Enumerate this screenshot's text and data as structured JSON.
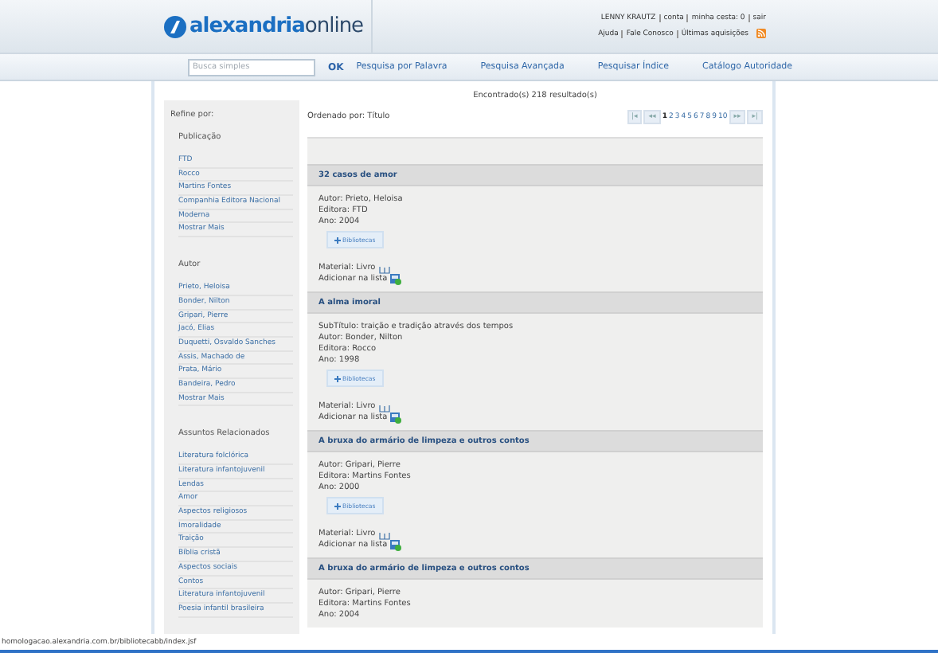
{
  "header": {
    "logo": {
      "part1": "alexandria",
      "part2": "online"
    },
    "user_links": [
      "LENNY KRAUTZ",
      "conta",
      "minha cesta: 0",
      "sair"
    ],
    "help_links": [
      "Ajuda",
      "Fale Conosco",
      "Últimas aquisições"
    ]
  },
  "nav": {
    "search": {
      "placeholder": "Busca simples"
    },
    "button": "OK",
    "links": [
      "Pesquisa por Palavra",
      "Pesquisa Avançada",
      "Pesquisar Índice",
      "Catálogo Autoridade"
    ]
  },
  "sidebar": {
    "title": "Refine por:",
    "groups": [
      {
        "title": "Publicação",
        "items": [
          "FTD",
          "Rocco",
          "Martins Fontes",
          "Companhia Editora Nacional",
          "Moderna",
          "Mostrar Mais"
        ]
      },
      {
        "title": "Autor",
        "items": [
          "Prieto, Heloisa",
          "Bonder, Nilton",
          "Gripari, Pierre",
          "Jacó, Elias",
          "Duquetti, Osvaldo Sanches",
          "Assis, Machado de",
          "Prata, Mário",
          "Bandeira, Pedro",
          "Mostrar Mais"
        ]
      },
      {
        "title": "Assuntos Relacionados",
        "items": [
          "Literatura folclórica",
          "Literatura infantojuvenil",
          "Lendas",
          "Amor",
          "Aspectos religiosos",
          "Imoralidade",
          "Traição",
          "Bíblia cristã",
          "Aspectos sociais",
          "Contos",
          "Literatura infantojuvenil",
          "Poesia infantil brasileira"
        ]
      }
    ]
  },
  "results": {
    "count": "Encontrado(s) 218 resultado(s)",
    "sort": "Ordenado por: Título",
    "pagination": {
      "first": "|◂",
      "prev": "◂◂",
      "pages": [
        {
          "label": "1",
          "selected": true
        },
        {
          "label": "2",
          "selected": false
        },
        {
          "label": "3",
          "selected": false
        },
        {
          "label": "4",
          "selected": false
        },
        {
          "label": "5",
          "selected": false
        },
        {
          "label": "6",
          "selected": false
        },
        {
          "label": "7",
          "selected": false
        },
        {
          "label": "8",
          "selected": false
        },
        {
          "label": "9",
          "selected": false
        },
        {
          "label": "10",
          "selected": false
        }
      ],
      "next": "▸▸",
      "last": "▸|"
    },
    "records": [
      {
        "title": "32 casos de amor",
        "lines": [
          "Autor: Prieto, Heloisa",
          "Editora: FTD",
          "Ano: 2004"
        ],
        "button": "Bibliotecas",
        "material": "Material: Livro",
        "add": "Adicionar na lista"
      },
      {
        "title": "A alma imoral",
        "lines": [
          "SubTítulo: traição e tradição através dos tempos",
          "Autor: Bonder, Nilton",
          "Editora: Rocco",
          "Ano: 1998"
        ],
        "button": "Bibliotecas",
        "material": "Material: Livro",
        "add": "Adicionar na lista"
      },
      {
        "title": "A bruxa do armário de limpeza e outros contos",
        "lines": [
          "Autor: Gripari, Pierre",
          "Editora: Martins Fontes",
          "Ano: 2000"
        ],
        "button": "Bibliotecas",
        "material": "Material: Livro",
        "add": "Adicionar na lista"
      },
      {
        "title": "A bruxa do armário de limpeza e outros contos",
        "lines": [
          "Autor: Gripari, Pierre",
          "Editora: Martins Fontes",
          "Ano: 2004"
        ]
      }
    ]
  },
  "status_bar": {
    "url": "homologacao.alexandria.com.br/bibliotecabb/index.jsf"
  }
}
